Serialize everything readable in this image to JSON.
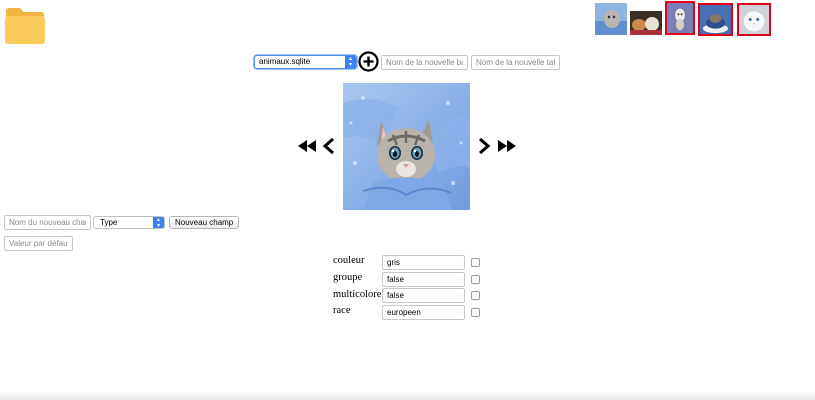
{
  "thumbnails": [
    {
      "name": "thumb-kitten-blanket",
      "selected": false
    },
    {
      "name": "thumb-dogs",
      "selected": false
    },
    {
      "name": "thumb-kitten-jump",
      "selected": true
    },
    {
      "name": "thumb-cat-cup",
      "selected": true
    },
    {
      "name": "thumb-white-kitten",
      "selected": true
    }
  ],
  "toolbar": {
    "database_value": "animaux.sqlite",
    "new_base_placeholder": "Nom de la nouvelle base",
    "new_table_placeholder": "Nom de la nouvelle table"
  },
  "fields": {
    "new_field_placeholder": "Nom du nouveau champ",
    "type_value": "Type",
    "new_field_button": "Nouveau champ",
    "default_placeholder": "Valeur par défaut"
  },
  "attributes": [
    {
      "label": "couleur",
      "value": "gris"
    },
    {
      "label": "groupe",
      "value": "false"
    },
    {
      "label": "multicolore",
      "value": "false"
    },
    {
      "label": "race",
      "value": "europeen"
    }
  ],
  "colors": {
    "selected_border": "#e0001a",
    "folder": "#fbcb5c",
    "select_accent": "#3b82f0"
  }
}
